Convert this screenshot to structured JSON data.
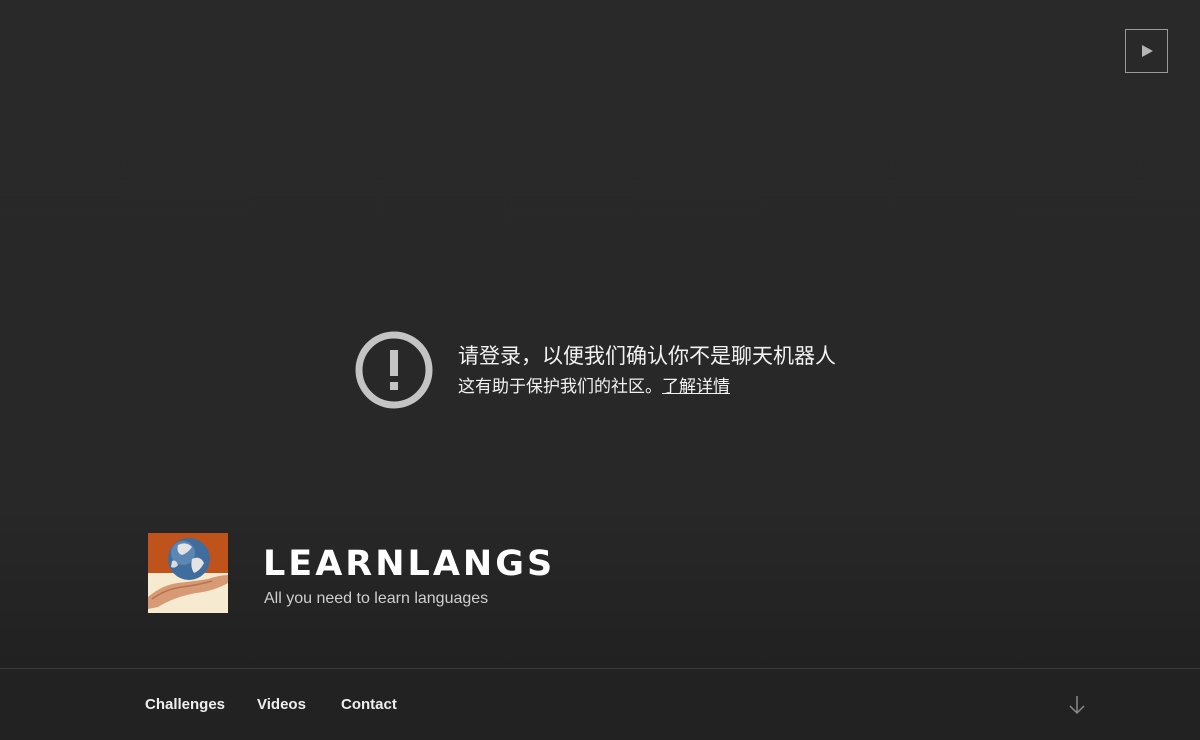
{
  "video": {
    "play_icon": "play-icon"
  },
  "notice": {
    "icon": "exclamation-circle-icon",
    "title": "请登录，以便我们确认你不是聊天机器人",
    "subtitle": "这有助于保护我们的社区。",
    "link_label": "了解详情"
  },
  "branding": {
    "logo_icon": "globe-in-hand-logo",
    "site_title": "LEARNLANGS",
    "site_description": "All you need to learn languages"
  },
  "nav": {
    "items": [
      {
        "label": "Challenges"
      },
      {
        "label": "Videos"
      },
      {
        "label": "Contact"
      }
    ],
    "scroll_icon": "arrow-down-icon"
  },
  "colors": {
    "background": "#282828",
    "nav_background": "#222222",
    "text": "#f2f2f2",
    "icon_gray": "#c4c4c4",
    "logo_orange": "#c0531b"
  }
}
